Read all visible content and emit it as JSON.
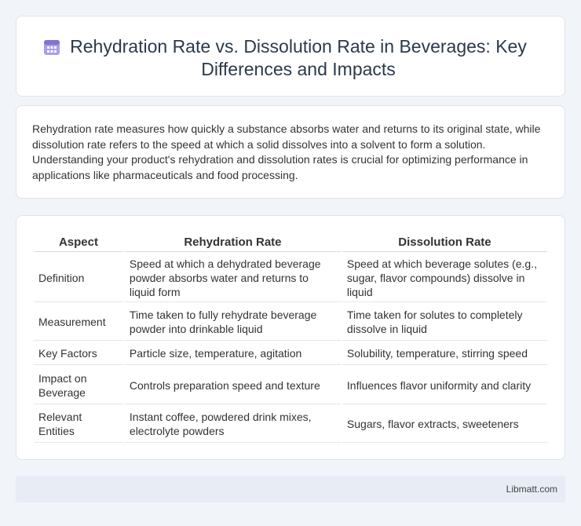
{
  "header": {
    "title": "Rehydration Rate vs. Dissolution Rate in Beverages: Key Differences and Impacts",
    "icon": "calendar-icon",
    "icon_color": "#8f86d8"
  },
  "intro": {
    "text": "Rehydration rate measures how quickly a substance absorbs water and returns to its original state, while dissolution rate refers to the speed at which a solid dissolves into a solvent to form a solution. Understanding your product's rehydration and dissolution rates is crucial for optimizing performance in applications like pharmaceuticals and food processing."
  },
  "table": {
    "headers": [
      "Aspect",
      "Rehydration Rate",
      "Dissolution Rate"
    ],
    "rows": [
      [
        "Definition",
        "Speed at which a dehydrated beverage powder absorbs water and returns to liquid form",
        "Speed at which beverage solutes (e.g., sugar, flavor compounds) dissolve in liquid"
      ],
      [
        "Measurement",
        "Time taken to fully rehydrate beverage powder into drinkable liquid",
        "Time taken for solutes to completely dissolve in liquid"
      ],
      [
        "Key Factors",
        "Particle size, temperature, agitation",
        "Solubility, temperature, stirring speed"
      ],
      [
        "Impact on Beverage",
        "Controls preparation speed and texture",
        "Influences flavor uniformity and clarity"
      ],
      [
        "Relevant Entities",
        "Instant coffee, powdered drink mixes, electrolyte powders",
        "Sugars, flavor extracts, sweeteners"
      ]
    ]
  },
  "footer": {
    "text": "Libmatt.com"
  }
}
